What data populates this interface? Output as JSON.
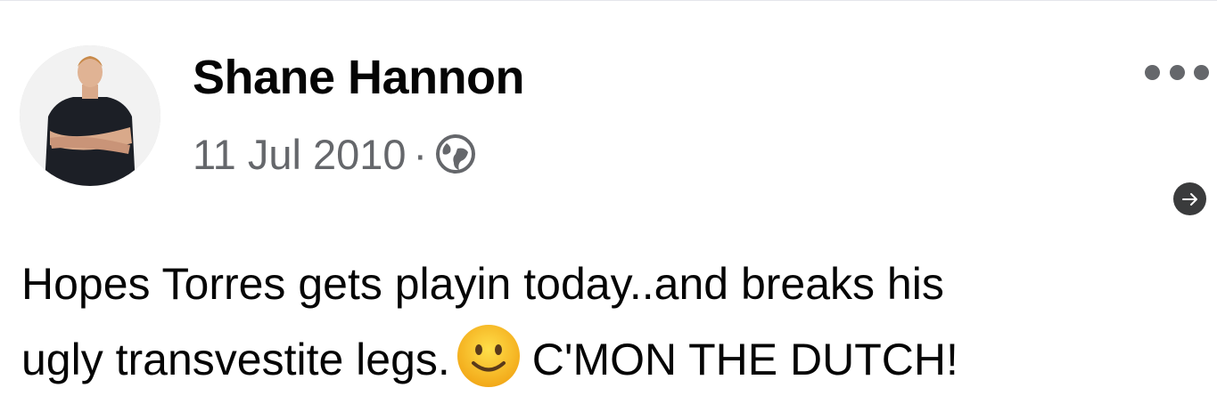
{
  "post": {
    "author": "Shane Hannon",
    "date": "11 Jul 2010",
    "separator": "·",
    "audience_icon": "globe-icon",
    "text_line1": "Hopes Torres gets playin today..and breaks his",
    "text_line2": "ugly transvestite legs.",
    "emoji": "slightly-smiling-face",
    "text_line3": "C'MON THE DUTCH!"
  },
  "icons": {
    "more": "more-options-icon",
    "share": "arrow-right-icon"
  },
  "colors": {
    "text": "#050505",
    "meta": "#65676b",
    "share_bg": "#3a3b3c",
    "emoji": "#f9c31e"
  }
}
